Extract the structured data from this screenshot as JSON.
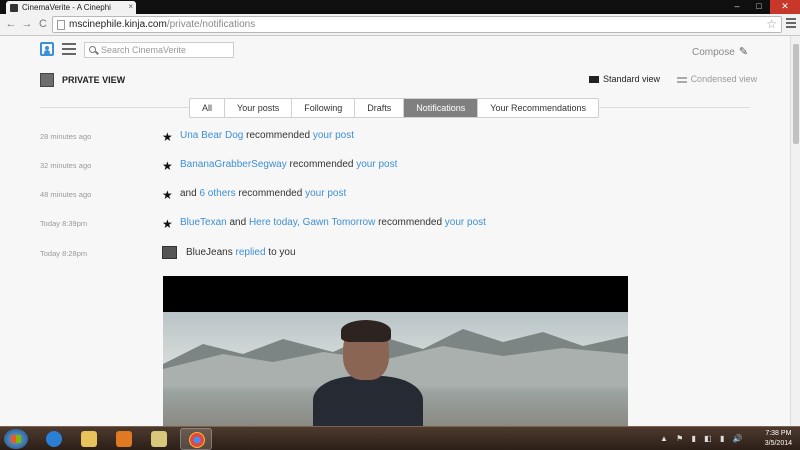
{
  "browser": {
    "tab_title": "CinemaVerite - A Cinephi",
    "tab_close": "×",
    "url_host": "mscinephile.kinja.com",
    "url_path": "/private/notifications",
    "back_glyph": "←",
    "forward_glyph": "→",
    "reload_glyph": "C",
    "star_glyph": "☆",
    "win_minimize": "–",
    "win_maximize": "□",
    "win_close": "✕"
  },
  "header": {
    "search_placeholder": "Search CinemaVerite",
    "compose_label": "Compose",
    "compose_icon": "✎"
  },
  "view": {
    "title": "PRIVATE VIEW",
    "standard_label": "Standard view",
    "condensed_label": "Condensed view"
  },
  "tabs": [
    {
      "label": "All"
    },
    {
      "label": "Your posts"
    },
    {
      "label": "Following"
    },
    {
      "label": "Drafts"
    },
    {
      "label": "Notifications"
    },
    {
      "label": "Your Recommendations"
    }
  ],
  "active_tab": "Notifications",
  "notifications": [
    {
      "time": "28 minutes ago",
      "actor": "Una Bear Dog",
      "action": " recommended ",
      "target": "your post"
    },
    {
      "time": "32 minutes ago",
      "actor": "BananaGrabberSegway",
      "action": " recommended ",
      "target": "your post"
    },
    {
      "time": "48 minutes ago",
      "prefix": "and ",
      "actor": "6 others",
      "action": " recommended ",
      "target": "your post"
    },
    {
      "time": "Today 8:39pm",
      "actor": "BlueTexan",
      "joiner": " and ",
      "actor2": "Here today, Gawn Tomorrow",
      "action": " recommended ",
      "target": "your post"
    },
    {
      "time": "Today 8:28pm",
      "actor": "BlueJeans ",
      "link": "replied",
      "suffix": " to you"
    }
  ],
  "star_glyph": "★",
  "taskbar": {
    "time": "7:38 PM",
    "date": "3/5/2014",
    "tray_icons": "▲ ⚑ ▮ ◧ ▮ 🔊"
  },
  "colors": {
    "link": "#3d8fd6",
    "active_tab_bg": "#808080",
    "page_bg": "#f7f7f7"
  }
}
